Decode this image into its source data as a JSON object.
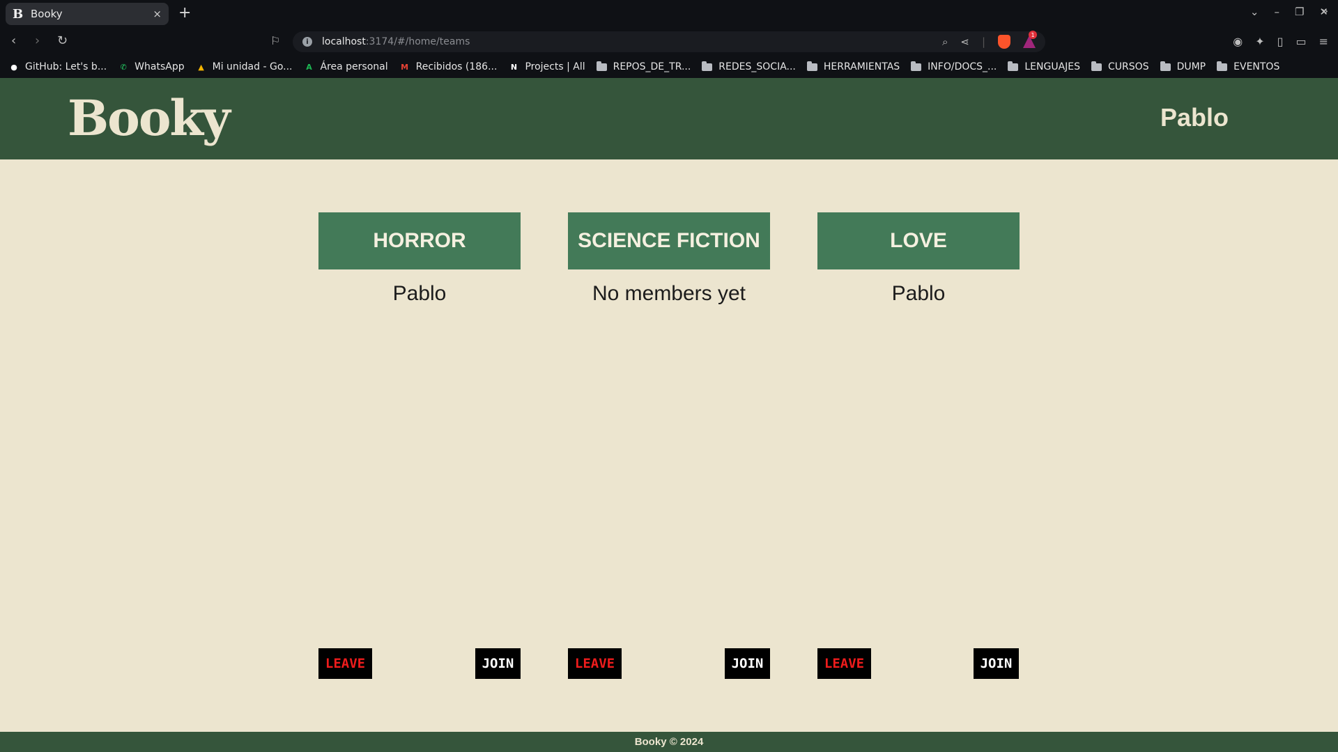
{
  "browser": {
    "tab_title": "Booky",
    "tab_favicon": "B",
    "tab_close": "×",
    "new_tab": "+",
    "url_host": "localhost",
    "url_path": ":3174/#/home/teams",
    "rewards_count": "1",
    "bookmarks": [
      {
        "label": "GitHub: Let's b...",
        "icon": "github-icon",
        "glyph": "●",
        "color": "#ffffff"
      },
      {
        "label": "WhatsApp",
        "icon": "whatsapp-icon",
        "glyph": "✆",
        "color": "#25d366"
      },
      {
        "label": "Mi unidad - Go...",
        "icon": "google-drive-icon",
        "glyph": "▲",
        "color": "#f4b400"
      },
      {
        "label": "Área personal",
        "icon": "area-personal-icon",
        "glyph": "A",
        "color": "#1db954"
      },
      {
        "label": "Recibidos (186...",
        "icon": "gmail-icon",
        "glyph": "M",
        "color": "#ea4335"
      },
      {
        "label": "Projects | All",
        "icon": "notion-icon",
        "glyph": "N",
        "color": "#ffffff"
      },
      {
        "label": "REPOS_DE_TR...",
        "icon": "folder-icon"
      },
      {
        "label": "REDES_SOCIA...",
        "icon": "folder-icon"
      },
      {
        "label": "HERRAMIENTAS",
        "icon": "folder-icon"
      },
      {
        "label": "INFO/DOCS_...",
        "icon": "folder-icon"
      },
      {
        "label": "LENGUAJES",
        "icon": "folder-icon"
      },
      {
        "label": "CURSOS",
        "icon": "folder-icon"
      },
      {
        "label": "DUMP",
        "icon": "folder-icon"
      },
      {
        "label": "EVENTOS",
        "icon": "folder-icon"
      }
    ]
  },
  "header": {
    "logo": "Booky",
    "username": "Pablo"
  },
  "teams": [
    {
      "name": "HORROR",
      "members": "Pablo",
      "leave_label": "LEAVE",
      "join_label": "JOIN"
    },
    {
      "name": "SCIENCE FICTION",
      "members": "No members yet",
      "leave_label": "LEAVE",
      "join_label": "JOIN"
    },
    {
      "name": "LOVE",
      "members": "Pablo",
      "leave_label": "LEAVE",
      "join_label": "JOIN"
    }
  ],
  "footer": {
    "text": "Booky © 2024"
  },
  "colors": {
    "header_bg": "#35553b",
    "page_bg": "#ece5cf",
    "team_title_bg": "#437a58",
    "leave_text": "#ee1c1c",
    "join_text": "#ffffff"
  }
}
